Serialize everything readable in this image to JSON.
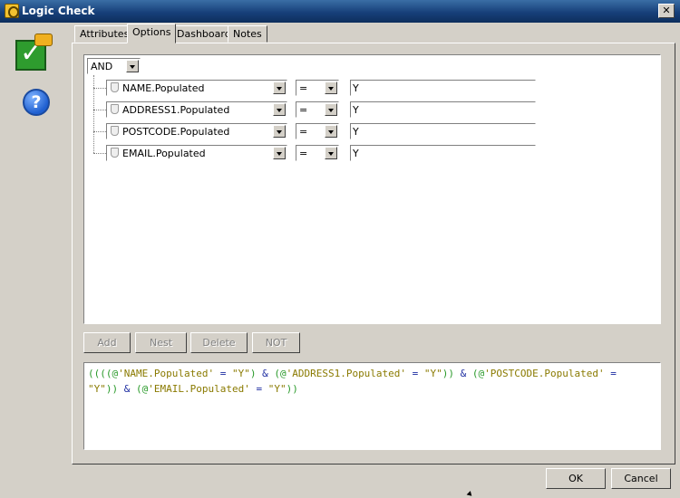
{
  "window": {
    "title": "Logic Check",
    "close_glyph": "✕"
  },
  "side_icons": {
    "main_icon": "logic-check-plug-icon",
    "help_icon": "help-icon",
    "help_glyph": "?"
  },
  "tabs": [
    {
      "label": "Attributes",
      "active": false
    },
    {
      "label": "Options",
      "active": true
    },
    {
      "label": "Dashboard",
      "active": false
    },
    {
      "label": "Notes",
      "active": false
    }
  ],
  "root_operator": "AND",
  "conditions": [
    {
      "field": "NAME.Populated",
      "operator": "=",
      "value": "Y"
    },
    {
      "field": "ADDRESS1.Populated",
      "operator": "=",
      "value": "Y"
    },
    {
      "field": "POSTCODE.Populated",
      "operator": "=",
      "value": "Y"
    },
    {
      "field": "EMAIL.Populated",
      "operator": "=",
      "value": "Y"
    }
  ],
  "condition_buttons": {
    "add": "Add",
    "nest": "Nest",
    "delete": "Delete",
    "not": "NOT"
  },
  "expression": {
    "l1_a": "((((@",
    "l1_b": "'NAME.Populated'",
    "l1_c": " = ",
    "l1_d": "\"Y\"",
    "l1_e": ") ",
    "l1_f": "&",
    "l1_g": " (@",
    "l1_h": "'ADDRESS1.Populated'",
    "l1_i": " = ",
    "l1_j": "\"Y\"",
    "l1_k": ")) ",
    "l1_l": "&",
    "l1_m": " (@",
    "l1_n": "'POSTCODE.Populated'",
    "l1_o": " =",
    "l2_a": "\"Y\"",
    "l2_b": ")) ",
    "l2_c": "&",
    "l2_d": " (@",
    "l2_e": "'EMAIL.Populated'",
    "l2_f": " = ",
    "l2_g": "\"Y\"",
    "l2_h": "))"
  },
  "dialog_buttons": {
    "ok": "OK",
    "cancel": "Cancel"
  }
}
